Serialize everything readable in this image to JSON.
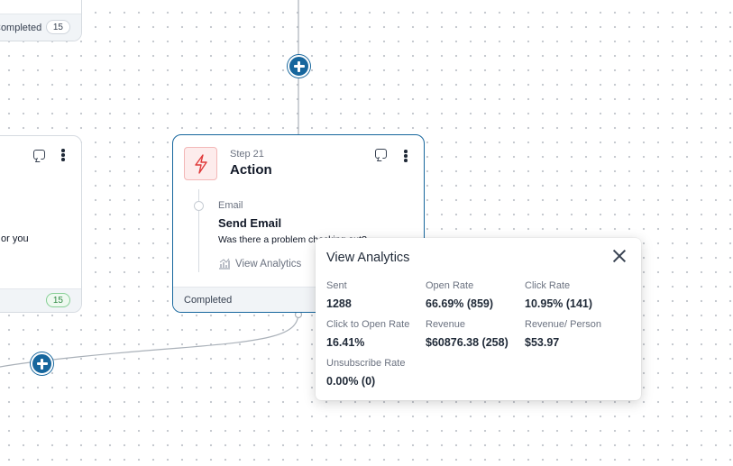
{
  "canvas": {
    "top_card": {
      "status": "Completed",
      "count": "15"
    },
    "left_card": {
      "snippet": "or you",
      "count": "15"
    }
  },
  "step": {
    "number_label": "Step 21",
    "title": "Action",
    "icon": "lightning-bolt-icon",
    "email_type": "Email",
    "email_name": "Send Email",
    "email_subject": "Was there a problem checking out?",
    "view_analytics": "View Analytics",
    "status": "Completed"
  },
  "analytics": {
    "title": "View Analytics",
    "metrics": {
      "sent": {
        "label": "Sent",
        "value": "1288"
      },
      "open_rate": {
        "label": "Open Rate",
        "value": "66.69% (859)"
      },
      "click_rate": {
        "label": "Click Rate",
        "value": "10.95% (141)"
      },
      "click_to_open": {
        "label": "Click to Open Rate",
        "value": "16.41%"
      },
      "revenue": {
        "label": "Revenue",
        "value": "$60876.38 (258)"
      },
      "revenue_per_person": {
        "label": "Revenue/ Person",
        "value": "$53.97"
      },
      "unsubscribe_rate": {
        "label": "Unsubscribe Rate",
        "value": "0.00% (0)"
      }
    }
  },
  "colors": {
    "accent": "#16669d",
    "action_icon": "#e03a3a",
    "badge_green": "#2e8a43"
  }
}
